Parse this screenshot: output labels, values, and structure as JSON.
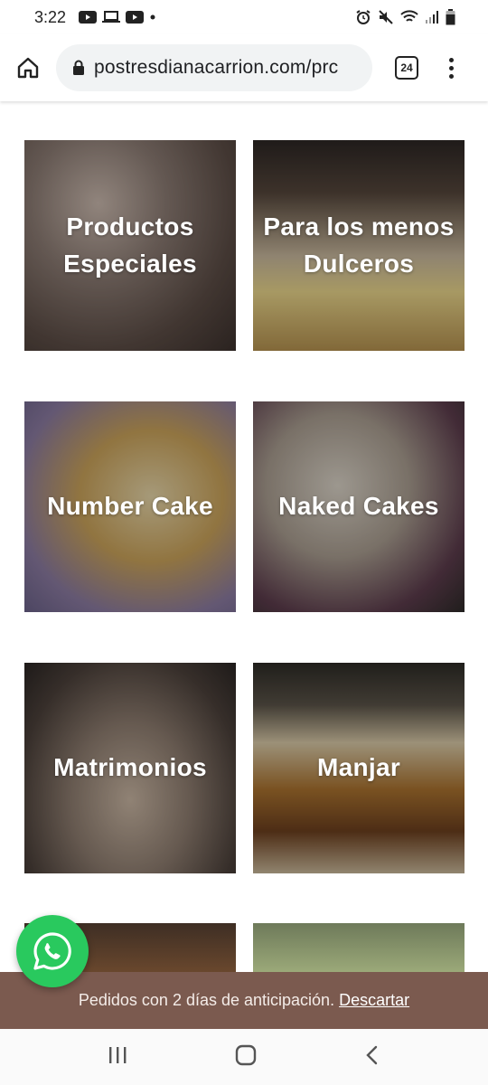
{
  "status_bar": {
    "time": "3:22",
    "left_icons": [
      "youtube-icon",
      "laptop-icon",
      "youtube-icon",
      "dot-icon"
    ],
    "right_icons": [
      "alarm-icon",
      "mute-icon",
      "wifi-icon",
      "signal-icon",
      "battery-icon"
    ]
  },
  "browser": {
    "url": "postresdianacarrion.com/prc",
    "tab_count": "24"
  },
  "categories": [
    {
      "label_line1": "Productos",
      "label_line2": "Especiales"
    },
    {
      "label_line1": "Para los menos",
      "label_line2": "Dulceros"
    },
    {
      "label_line1": "Number Cake",
      "label_line2": ""
    },
    {
      "label_line1": "Naked Cakes",
      "label_line2": ""
    },
    {
      "label_line1": "Matrimonios",
      "label_line2": ""
    },
    {
      "label_line1": "Manjar",
      "label_line2": ""
    }
  ],
  "notice": {
    "text": "Pedidos con 2 días de anticipación.",
    "dismiss_label": "Descartar",
    "background": "#7b5a4f"
  },
  "whatsapp": {
    "icon": "whatsapp-icon",
    "color": "#29c95e"
  },
  "nav_bar": {
    "icons": [
      "recent-apps-icon",
      "home-icon",
      "back-icon"
    ]
  }
}
